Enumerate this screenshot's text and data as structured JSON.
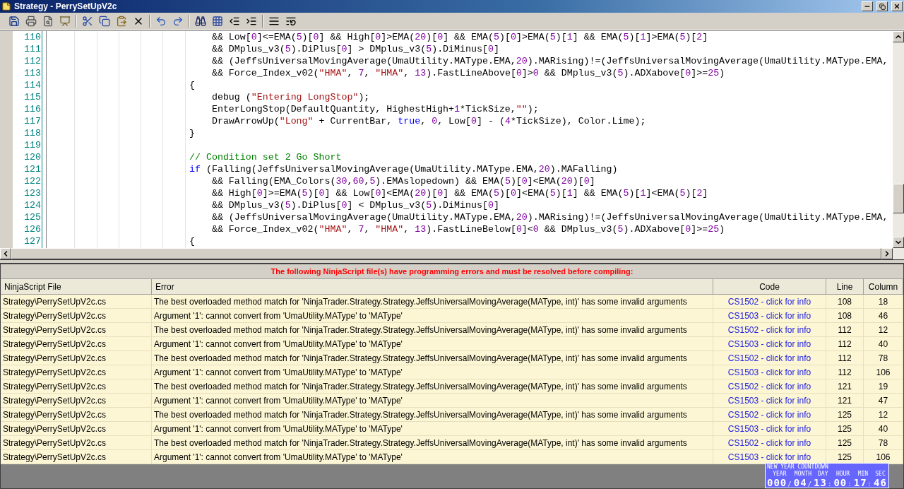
{
  "window": {
    "title": "Strategy - PerrySetUpV2c"
  },
  "editor": {
    "lines": [
      {
        "number": "110",
        "parts": [
          {
            "kind": "code",
            "text": "    && Low[0]<=EMA(5)[0] && High[0]>EMA(20)[0] && EMA(5)[0]>EMA(5)[1] && EMA(5)[1]>EMA(5)[2]"
          }
        ]
      },
      {
        "number": "111",
        "parts": [
          {
            "kind": "code",
            "text": "    && DMplus_v3(5).DiPlus[0] > DMplus_v3(5).DiMinus[0]"
          }
        ]
      },
      {
        "number": "112",
        "parts": [
          {
            "kind": "code",
            "text": "    && (JeffsUniversalMovingAverage(UmaUtility.MAType.EMA,20).MARising)!=(JeffsUniversalMovingAverage(UmaUtility.MAType.EMA,"
          }
        ]
      },
      {
        "number": "113",
        "parts": [
          {
            "kind": "code",
            "text": "    && Force_Index_v02(\"HMA\", 7, \"HMA\", 13).FastLineAbove[0]>0 && DMplus_v3(5).ADXabove[0]>=25)"
          }
        ]
      },
      {
        "number": "114",
        "parts": [
          {
            "kind": "code",
            "text": "{"
          }
        ]
      },
      {
        "number": "115",
        "parts": [
          {
            "kind": "code",
            "text": "    debug (\"Entering LongStop\");"
          }
        ]
      },
      {
        "number": "116",
        "parts": [
          {
            "kind": "code",
            "text": "    EnterLongStop(DefaultQuantity, HighestHigh+1*TickSize,\"\");"
          }
        ]
      },
      {
        "number": "117",
        "parts": [
          {
            "kind": "code",
            "text": "    DrawArrowUp(\"Long\" + CurrentBar, "
          },
          {
            "kind": "keyword",
            "text": "true"
          },
          {
            "kind": "code",
            "text": ", 0, Low[0] - (4*TickSize), Color.Lime);"
          }
        ]
      },
      {
        "number": "118",
        "parts": [
          {
            "kind": "code",
            "text": "}"
          }
        ]
      },
      {
        "number": "119"
      },
      {
        "number": "120",
        "parts": [
          {
            "kind": "comment",
            "text": "// Condition set 2 Go Short"
          }
        ]
      },
      {
        "number": "121",
        "parts": [
          {
            "kind": "keyword",
            "text": "if"
          },
          {
            "kind": "code",
            "text": " (Falling(JeffsUniversalMovingAverage(UmaUtility.MAType.EMA,20).MAFalling)"
          }
        ]
      },
      {
        "number": "122",
        "parts": [
          {
            "kind": "code",
            "text": "    && Falling(EMA_Colors(30,60,5).EMAslopedown) && EMA(5)[0]<EMA(20)[0]"
          }
        ]
      },
      {
        "number": "123",
        "parts": [
          {
            "kind": "code",
            "text": "    && High[0]>=EMA(5)[0] && Low[0]<EMA(20)[0] && EMA(5)[0]<EMA(5)[1] && EMA(5)[1]<EMA(5)[2]"
          }
        ]
      },
      {
        "number": "124",
        "parts": [
          {
            "kind": "code",
            "text": "    && DMplus_v3(5).DiPlus[0] < DMplus_v3(5).DiMinus[0]"
          }
        ]
      },
      {
        "number": "125",
        "parts": [
          {
            "kind": "code",
            "text": "    && (JeffsUniversalMovingAverage(UmaUtility.MAType.EMA,20).MARising)!=(JeffsUniversalMovingAverage(UmaUtility.MAType.EMA,"
          }
        ]
      },
      {
        "number": "126",
        "parts": [
          {
            "kind": "code",
            "text": "    && Force_Index_v02(\"HMA\", 7, \"HMA\", 13).FastLineBelow[0]<0 && DMplus_v3(5).ADXabove[0]>=25)"
          }
        ]
      },
      {
        "number": "127",
        "parts": [
          {
            "kind": "code",
            "text": "{"
          }
        ]
      }
    ]
  },
  "errors": {
    "message": "The following NinjaScript file(s) have programming errors and must be resolved before compiling:",
    "columns": [
      "NinjaScript File",
      "Error",
      "Code",
      "Line",
      "Column"
    ],
    "rows": [
      {
        "file": "Strategy\\PerrySetUpV2c.cs",
        "error": "The best overloaded method match for 'NinjaTrader.Strategy.Strategy.JeffsUniversalMovingAverage(MAType, int)' has some invalid arguments",
        "code": "CS1502 - click for info",
        "line": "108",
        "column": "18"
      },
      {
        "file": "Strategy\\PerrySetUpV2c.cs",
        "error": "Argument '1': cannot convert from 'UmaUtility.MAType' to 'MAType'",
        "code": "CS1503 - click for info",
        "line": "108",
        "column": "46"
      },
      {
        "file": "Strategy\\PerrySetUpV2c.cs",
        "error": "The best overloaded method match for 'NinjaTrader.Strategy.Strategy.JeffsUniversalMovingAverage(MAType, int)' has some invalid arguments",
        "code": "CS1502 - click for info",
        "line": "112",
        "column": "12"
      },
      {
        "file": "Strategy\\PerrySetUpV2c.cs",
        "error": "Argument '1': cannot convert from 'UmaUtility.MAType' to 'MAType'",
        "code": "CS1503 - click for info",
        "line": "112",
        "column": "40"
      },
      {
        "file": "Strategy\\PerrySetUpV2c.cs",
        "error": "The best overloaded method match for 'NinjaTrader.Strategy.Strategy.JeffsUniversalMovingAverage(MAType, int)' has some invalid arguments",
        "code": "CS1502 - click for info",
        "line": "112",
        "column": "78"
      },
      {
        "file": "Strategy\\PerrySetUpV2c.cs",
        "error": "Argument '1': cannot convert from 'UmaUtility.MAType' to 'MAType'",
        "code": "CS1503 - click for info",
        "line": "112",
        "column": "106"
      },
      {
        "file": "Strategy\\PerrySetUpV2c.cs",
        "error": "The best overloaded method match for 'NinjaTrader.Strategy.Strategy.JeffsUniversalMovingAverage(MAType, int)' has some invalid arguments",
        "code": "CS1502 - click for info",
        "line": "121",
        "column": "19"
      },
      {
        "file": "Strategy\\PerrySetUpV2c.cs",
        "error": "Argument '1': cannot convert from 'UmaUtility.MAType' to 'MAType'",
        "code": "CS1503 - click for info",
        "line": "121",
        "column": "47"
      },
      {
        "file": "Strategy\\PerrySetUpV2c.cs",
        "error": "The best overloaded method match for 'NinjaTrader.Strategy.Strategy.JeffsUniversalMovingAverage(MAType, int)' has some invalid arguments",
        "code": "CS1502 - click for info",
        "line": "125",
        "column": "12"
      },
      {
        "file": "Strategy\\PerrySetUpV2c.cs",
        "error": "Argument '1': cannot convert from 'UmaUtility.MAType' to 'MAType'",
        "code": "CS1503 - click for info",
        "line": "125",
        "column": "40"
      },
      {
        "file": "Strategy\\PerrySetUpV2c.cs",
        "error": "The best overloaded method match for 'NinjaTrader.Strategy.Strategy.JeffsUniversalMovingAverage(MAType, int)' has some invalid arguments",
        "code": "CS1502 - click for info",
        "line": "125",
        "column": "78"
      },
      {
        "file": "Strategy\\PerrySetUpV2c.cs",
        "error": "Argument '1': cannot convert from 'UmaUtility.MAType' to 'MAType'",
        "code": "CS1503 - click for info",
        "line": "125",
        "column": "106"
      }
    ]
  },
  "countdown": {
    "title": "NEW YEAR COUNTDOWN",
    "fields": [
      {
        "label": "YEAR",
        "value": "000",
        "separator": "/"
      },
      {
        "label": "MONTH",
        "value": "04",
        "separator": "/"
      },
      {
        "label": "DAY",
        "value": "13",
        "separator": ":"
      },
      {
        "label": "HOUR",
        "value": "00",
        "separator": ":"
      },
      {
        "label": "MIN",
        "value": "17",
        "separator": ":"
      },
      {
        "label": "SEC",
        "value": "46"
      }
    ]
  }
}
